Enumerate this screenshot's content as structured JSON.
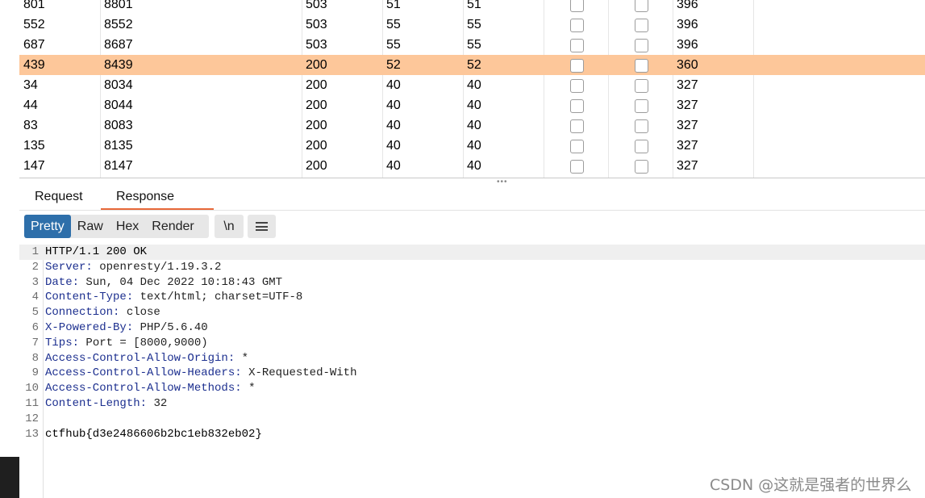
{
  "results_table": {
    "rows": [
      {
        "payload": "801",
        "port": "8801",
        "status": "503",
        "len_a": "51",
        "len_b": "51",
        "length": "396",
        "selected": false
      },
      {
        "payload": "552",
        "port": "8552",
        "status": "503",
        "len_a": "55",
        "len_b": "55",
        "length": "396",
        "selected": false
      },
      {
        "payload": "687",
        "port": "8687",
        "status": "503",
        "len_a": "55",
        "len_b": "55",
        "length": "396",
        "selected": false
      },
      {
        "payload": "439",
        "port": "8439",
        "status": "200",
        "len_a": "52",
        "len_b": "52",
        "length": "360",
        "selected": true
      },
      {
        "payload": "34",
        "port": "8034",
        "status": "200",
        "len_a": "40",
        "len_b": "40",
        "length": "327",
        "selected": false
      },
      {
        "payload": "44",
        "port": "8044",
        "status": "200",
        "len_a": "40",
        "len_b": "40",
        "length": "327",
        "selected": false
      },
      {
        "payload": "83",
        "port": "8083",
        "status": "200",
        "len_a": "40",
        "len_b": "40",
        "length": "327",
        "selected": false
      },
      {
        "payload": "135",
        "port": "8135",
        "status": "200",
        "len_a": "40",
        "len_b": "40",
        "length": "327",
        "selected": false
      },
      {
        "payload": "147",
        "port": "8147",
        "status": "200",
        "len_a": "40",
        "len_b": "40",
        "length": "327",
        "selected": false
      }
    ]
  },
  "tabs": {
    "request": "Request",
    "response": "Response",
    "active": "response"
  },
  "toolbar": {
    "pretty": "Pretty",
    "raw": "Raw",
    "hex": "Hex",
    "render": "Render",
    "newline": "\\n",
    "active": "pretty",
    "menu_icon": "hamburger-menu-icon"
  },
  "response_lines": [
    {
      "num": "1",
      "text": "HTTP/1.1 200 OK"
    },
    {
      "num": "2",
      "name": "Server",
      "value": "openresty/1.19.3.2"
    },
    {
      "num": "3",
      "name": "Date",
      "value": "Sun, 04 Dec 2022 10:18:43 GMT"
    },
    {
      "num": "4",
      "name": "Content-Type",
      "value": "text/html; charset=UTF-8"
    },
    {
      "num": "5",
      "name": "Connection",
      "value": "close"
    },
    {
      "num": "6",
      "name": "X-Powered-By",
      "value": "PHP/5.6.40"
    },
    {
      "num": "7",
      "name": "Tips",
      "value": "Port = [8000,9000)"
    },
    {
      "num": "8",
      "name": "Access-Control-Allow-Origin",
      "value": "*"
    },
    {
      "num": "9",
      "name": "Access-Control-Allow-Headers",
      "value": "X-Requested-With"
    },
    {
      "num": "10",
      "name": "Access-Control-Allow-Methods",
      "value": "*"
    },
    {
      "num": "11",
      "name": "Content-Length",
      "value": "32"
    },
    {
      "num": "12",
      "text": ""
    },
    {
      "num": "13",
      "text": "ctfhub{d3e2486606b2bc1eb832eb02}"
    }
  ],
  "watermark": "CSDN @这就是强者的世界么",
  "colors": {
    "selected_row": "#fdc79a",
    "active_tab_underline": "#e8693a",
    "active_button": "#2e6faa",
    "header_name": "#1c2f8f"
  }
}
